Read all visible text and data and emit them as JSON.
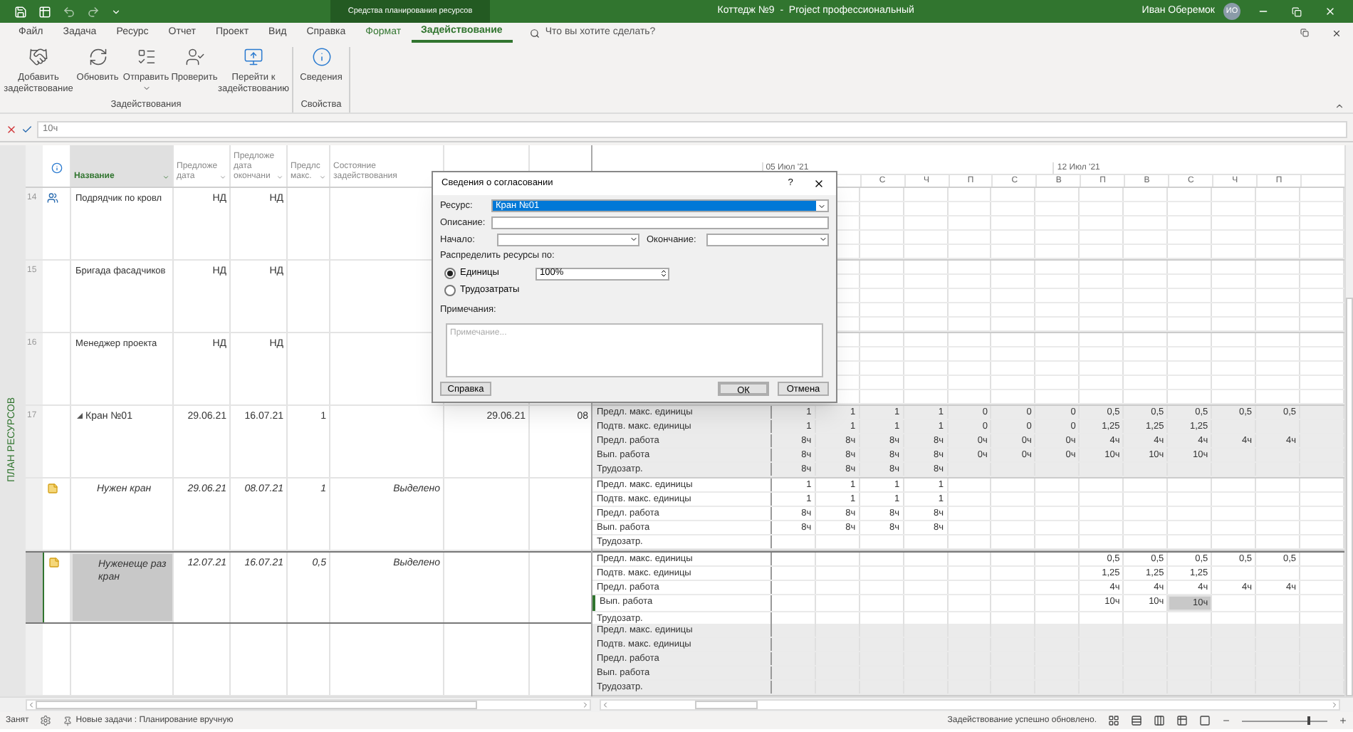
{
  "title_bar": {
    "context_group": "Средства планирования ресурсов",
    "title": "Коттедж №9  -  Project профессиональный",
    "user": "Иван Оберемок",
    "avatar": "ИО"
  },
  "tabs": [
    {
      "label": "Файл",
      "kind": "normal",
      "selected": false
    },
    {
      "label": "Задача",
      "kind": "normal",
      "selected": false
    },
    {
      "label": "Ресурс",
      "kind": "normal",
      "selected": false
    },
    {
      "label": "Отчет",
      "kind": "normal",
      "selected": false
    },
    {
      "label": "Проект",
      "kind": "normal",
      "selected": false
    },
    {
      "label": "Вид",
      "kind": "normal",
      "selected": false
    },
    {
      "label": "Справка",
      "kind": "normal",
      "selected": false
    },
    {
      "label": "Формат",
      "kind": "context",
      "selected": false
    },
    {
      "label": "Задействование",
      "kind": "context",
      "selected": true
    }
  ],
  "search": {
    "placeholder": "Что вы хотите сделать?"
  },
  "ribbon": {
    "groups": [
      {
        "label": "Задействования",
        "buttons": [
          {
            "label": "Добавить задействование",
            "dropdown": false
          },
          {
            "label": "Обновить",
            "dropdown": false
          },
          {
            "label": "Отправить",
            "dropdown": true
          },
          {
            "label": "Проверить",
            "dropdown": false
          },
          {
            "label": "Перейти к задействованию",
            "dropdown": false
          }
        ]
      },
      {
        "label": "Свойства",
        "buttons": [
          {
            "label": "Сведения",
            "dropdown": false
          }
        ]
      }
    ]
  },
  "formula_bar": {
    "value": "10ч"
  },
  "side_tab": "ПЛАН РЕСУРСОВ",
  "table": {
    "columns": [
      {
        "label": "Название",
        "selected": true
      },
      {
        "label": "Предложе дата",
        "selected": false
      },
      {
        "label": "Предложе дата окончани",
        "selected": false
      },
      {
        "label": "Предлс макс.",
        "selected": false
      },
      {
        "label": "Состояние задействования",
        "selected": false
      }
    ],
    "rows": [
      {
        "id": "14",
        "kind": "team",
        "name": "Подрядчик по кровл",
        "start": "НД",
        "finish": "НД",
        "selected": false
      },
      {
        "id": "15",
        "kind": "resource",
        "name": "Бригада фасадчиков",
        "start": "НД",
        "finish": "НД",
        "selected": false
      },
      {
        "id": "16",
        "kind": "resource",
        "name": "Менеджер проекта",
        "start": "НД",
        "finish": "НД",
        "selected": false
      },
      {
        "id": "17",
        "kind": "summary",
        "name": "Кран №01",
        "expanded": true,
        "start": "29.06.21",
        "finish": "16.07.21",
        "max": "1",
        "column_6": "29.06.21",
        "column_7": "08",
        "selected": false,
        "details": [
          {
            "label": "Предл. макс. единицы",
            "week_1": [
              "1",
              "1",
              "1",
              "1",
              "0",
              "0",
              "0"
            ],
            "week_2": [
              "0,5",
              "0,5",
              "0,5",
              "0,5",
              "0,5"
            ]
          },
          {
            "label": "Подтв. макс. единицы",
            "week_1": [
              "1",
              "1",
              "1",
              "1",
              "0",
              "0",
              "0"
            ],
            "week_2": [
              "1,25",
              "1,25",
              "1,25"
            ]
          },
          {
            "label": "Предл. работа",
            "week_1": [
              "8ч",
              "8ч",
              "8ч",
              "8ч",
              "0ч",
              "0ч",
              "0ч"
            ],
            "week_2": [
              "4ч",
              "4ч",
              "4ч",
              "4ч",
              "4ч"
            ]
          },
          {
            "label": "Вып. работа",
            "week_1": [
              "8ч",
              "8ч",
              "8ч",
              "8ч",
              "0ч",
              "0ч",
              "0ч"
            ],
            "week_2": [
              "10ч",
              "10ч",
              "10ч"
            ]
          },
          {
            "label": "Трудозатр.",
            "week_1": [
              "8ч",
              "8ч",
              "8ч",
              "8ч"
            ]
          }
        ]
      },
      {
        "kind": "assignment",
        "name": "Нужен кран",
        "start": "29.06.21",
        "finish": "08.07.21",
        "max": "1",
        "status": "Выделено",
        "selected": false,
        "details": [
          {
            "label": "Предл. макс. единицы",
            "week_1": [
              "1",
              "1",
              "1",
              "1"
            ]
          },
          {
            "label": "Подтв. макс. единицы",
            "week_1": [
              "1",
              "1",
              "1",
              "1"
            ]
          },
          {
            "label": "Предл. работа",
            "week_1": [
              "8ч",
              "8ч",
              "8ч",
              "8ч"
            ]
          },
          {
            "label": "Вып. работа",
            "week_1": [
              "8ч",
              "8ч",
              "8ч",
              "8ч"
            ]
          },
          {
            "label": "Трудозатр."
          }
        ]
      },
      {
        "kind": "assignment",
        "name": "Нуженеще раз кран",
        "start": "12.07.21",
        "finish": "16.07.21",
        "max": "0,5",
        "status": "Выделено",
        "selected": true,
        "details": [
          {
            "label": "Предл. макс. единицы",
            "week_2": [
              "0,5",
              "0,5",
              "0,5",
              "0,5",
              "0,5"
            ]
          },
          {
            "label": "Подтв. макс. единицы",
            "week_2": [
              "1,25",
              "1,25",
              "1,25"
            ]
          },
          {
            "label": "Предл. работа",
            "week_2": [
              "4ч",
              "4ч",
              "4ч",
              "4ч",
              "4ч"
            ]
          },
          {
            "label": "Вып. работа",
            "selected": true,
            "week_2": [
              "10ч",
              "10ч",
              {
                "text": "10ч",
                "selected": true
              }
            ]
          },
          {
            "label": "Трудозатр."
          }
        ]
      },
      {
        "kind": "empty",
        "selected": false,
        "details": [
          {
            "label": "Предл. макс. единицы"
          },
          {
            "label": "Подтв. макс. единицы"
          },
          {
            "label": "Предл. работа"
          },
          {
            "label": "Вып. работа"
          },
          {
            "label": "Трудозатр."
          }
        ]
      }
    ]
  },
  "timescale": {
    "weeks": [
      {
        "label": "05 Июл '21",
        "days": [
          "С",
          "Ч",
          "П",
          "С",
          "В"
        ]
      },
      {
        "label": "12 Июл '21",
        "days": [
          "П",
          "В",
          "С",
          "Ч",
          "П"
        ]
      }
    ]
  },
  "dialog": {
    "title": "Сведения о согласовании",
    "help": "?",
    "resource_label": "Ресурс:",
    "resource_value": "Кран №01",
    "description_label": "Описание:",
    "start_label": "Начало:",
    "finish_label": "Окончание:",
    "distribute_label": "Распределить ресурсы по:",
    "options": [
      {
        "label": "Единицы",
        "selected": true
      },
      {
        "label": "Трудозатраты",
        "selected": false
      }
    ],
    "units_value": "100%",
    "notes_label": "Примечания:",
    "notes_placeholder": "Примечание...",
    "buttons": [
      {
        "label": "Справка",
        "kind": "left"
      },
      {
        "label": "ОК",
        "kind": "default"
      },
      {
        "label": "Отмена",
        "kind": "normal"
      }
    ]
  },
  "status_bar": {
    "mode": "Занят",
    "new_tasks": "Новые задачи : Планирование вручную",
    "message": "Задействование успешно обновлено.",
    "zoom": {
      "level": 0.8
    }
  }
}
